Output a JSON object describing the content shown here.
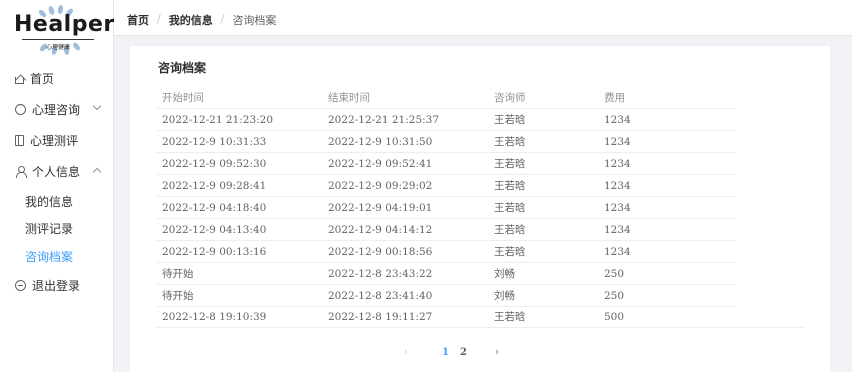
{
  "logo": {
    "text": "Healper",
    "subtitle": "心理健康"
  },
  "sidebar": {
    "items": [
      {
        "label": "首页",
        "icon": "home-icon"
      },
      {
        "label": "心理咨询",
        "icon": "chat-icon"
      },
      {
        "label": "心理测评",
        "icon": "book-icon"
      },
      {
        "label": "个人信息",
        "icon": "user-icon"
      },
      {
        "label": "退出登录",
        "icon": "exit-icon"
      }
    ],
    "sub_items": [
      {
        "label": "我的信息"
      },
      {
        "label": "测评记录"
      },
      {
        "label": "咨询档案"
      }
    ]
  },
  "breadcrumb": [
    "首页",
    "我的信息",
    "咨询档案"
  ],
  "breadcrumb_separator": "/",
  "card": {
    "title": "咨询档案"
  },
  "table": {
    "headers": [
      "开始时间",
      "结束时间",
      "咨询师",
      "费用"
    ],
    "rows": [
      [
        "2022-12-21 21:23:20",
        "2022-12-21 21:25:37",
        "王若晗",
        "1234"
      ],
      [
        "2022-12-9 10:31:33",
        "2022-12-9 10:31:50",
        "王若晗",
        "1234"
      ],
      [
        "2022-12-9 09:52:30",
        "2022-12-9 09:52:41",
        "王若晗",
        "1234"
      ],
      [
        "2022-12-9 09:28:41",
        "2022-12-9 09:29:02",
        "王若晗",
        "1234"
      ],
      [
        "2022-12-9 04:18:40",
        "2022-12-9 04:19:01",
        "王若晗",
        "1234"
      ],
      [
        "2022-12-9 04:13:40",
        "2022-12-9 04:14:12",
        "王若晗",
        "1234"
      ],
      [
        "2022-12-9 00:13:16",
        "2022-12-9 00:18:56",
        "王若晗",
        "1234"
      ],
      [
        "待开始",
        "2022-12-8 23:43:22",
        "刘畅",
        "250"
      ],
      [
        "待开始",
        "2022-12-8 23:41:40",
        "刘畅",
        "250"
      ],
      [
        "2022-12-8 19:10:39",
        "2022-12-8 19:11:27",
        "王若晗",
        "500"
      ]
    ]
  },
  "pagination": {
    "prev": "‹",
    "pages": [
      "1",
      "2"
    ],
    "current": "1",
    "next": "›"
  },
  "colors": {
    "accent": "#409eff",
    "border": "#ebeef5",
    "background": "#f0f2f5"
  }
}
